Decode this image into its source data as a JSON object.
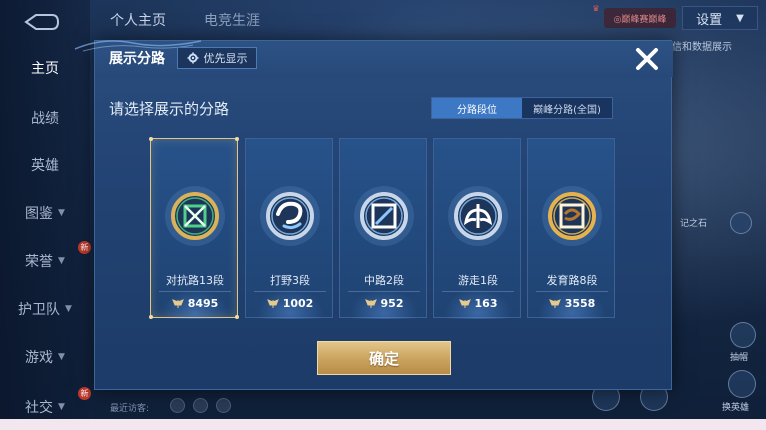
{
  "background": {
    "nav": [
      {
        "label": "主页",
        "active": true,
        "chevron": false,
        "badge": ""
      },
      {
        "label": "战绩",
        "active": false,
        "chevron": false,
        "badge": ""
      },
      {
        "label": "英雄",
        "active": false,
        "chevron": false,
        "badge": ""
      },
      {
        "label": "图鉴",
        "active": false,
        "chevron": true,
        "badge": ""
      },
      {
        "label": "荣誉",
        "active": false,
        "chevron": true,
        "badge": "新"
      },
      {
        "label": "护卫队",
        "active": false,
        "chevron": true,
        "badge": ""
      },
      {
        "label": "游戏",
        "active": false,
        "chevron": true,
        "badge": ""
      },
      {
        "label": "社交",
        "active": false,
        "chevron": true,
        "badge": "新"
      }
    ],
    "top_tabs": [
      "个人主页",
      "电竞生涯"
    ],
    "settings_label": "设置",
    "top_badge_text": "◎巅峰赛巅峰",
    "right_link": "信和数据展示",
    "right_items": [
      "记之石",
      "抽帽",
      "换英雄"
    ],
    "visitor_label": "最近访客:"
  },
  "modal": {
    "title": "展示分路",
    "priority_button": "优先显示",
    "subtitle": "请选择展示的分路",
    "toggle": [
      {
        "label": "分路段位",
        "active": true
      },
      {
        "label": "巅峰分路(全国)",
        "active": false
      }
    ],
    "cards": [
      {
        "name": "对抗路13段",
        "score": "8495",
        "selected": true,
        "emblem": "shield-crossed-swords-icon",
        "color": "#4fd08a",
        "ring": "#d9b25a"
      },
      {
        "name": "打野3段",
        "score": "1002",
        "selected": false,
        "emblem": "swirl-claw-icon",
        "color": "#8cc6ff",
        "ring": "#c7d6e8"
      },
      {
        "name": "中路2段",
        "score": "952",
        "selected": false,
        "emblem": "slash-square-icon",
        "color": "#8cc6ff",
        "ring": "#c7d6e8"
      },
      {
        "name": "游走1段",
        "score": "163",
        "selected": false,
        "emblem": "guardian-wings-icon",
        "color": "#8cc6ff",
        "ring": "#c7d6e8"
      },
      {
        "name": "发育路8段",
        "score": "3558",
        "selected": false,
        "emblem": "target-arrow-icon",
        "color": "#f0c25a",
        "ring": "#e6b24e"
      }
    ],
    "confirm_label": "确定"
  },
  "colors": {
    "modal_bg": "#224373",
    "selected_border": "#e3c584",
    "toggle_active": "#3d78c4",
    "confirm_gold": "#c9a25d"
  }
}
